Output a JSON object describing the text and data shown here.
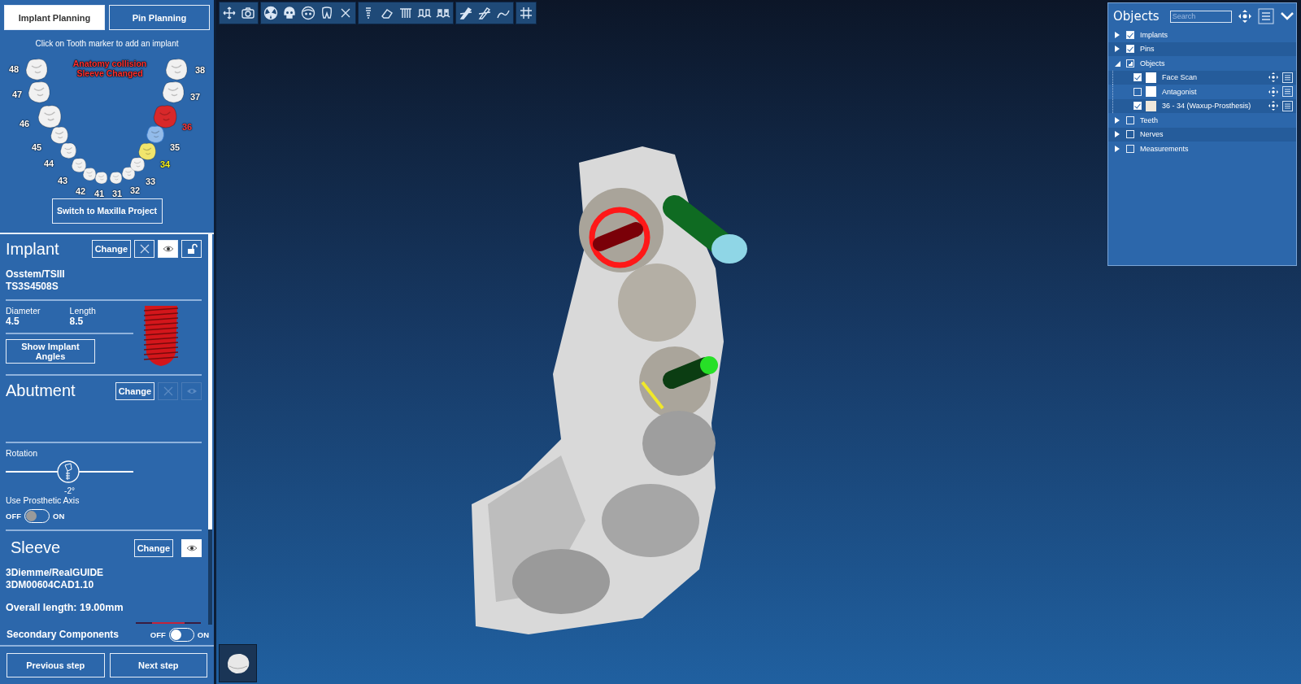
{
  "tabs": [
    {
      "label": "Implant Planning",
      "selected": true
    },
    {
      "label": "Pin Planning",
      "selected": false
    }
  ],
  "tooth_chart": {
    "hint": "Click on Tooth marker to add an implant",
    "warnings": [
      "Anatomy collision",
      "Sleeve Changed"
    ],
    "teeth": [
      {
        "label": "48",
        "implant": false,
        "selected": false,
        "highlighted": false
      },
      {
        "label": "47",
        "implant": false,
        "selected": false,
        "highlighted": false
      },
      {
        "label": "46",
        "implant": false,
        "selected": false,
        "highlighted": false
      },
      {
        "label": "45",
        "implant": false,
        "selected": false,
        "highlighted": false
      },
      {
        "label": "44",
        "implant": false,
        "selected": false,
        "highlighted": false
      },
      {
        "label": "43",
        "implant": false,
        "selected": false,
        "highlighted": false
      },
      {
        "label": "42",
        "implant": false,
        "selected": false,
        "highlighted": false
      },
      {
        "label": "41",
        "implant": false,
        "selected": false,
        "highlighted": false
      },
      {
        "label": "31",
        "implant": false,
        "selected": false,
        "highlighted": false
      },
      {
        "label": "32",
        "implant": false,
        "selected": false,
        "highlighted": false
      },
      {
        "label": "33",
        "implant": false,
        "selected": false,
        "highlighted": false
      },
      {
        "label": "34",
        "implant": false,
        "selected": true,
        "highlighted": false
      },
      {
        "label": "35",
        "implant": false,
        "selected": false,
        "highlighted": true
      },
      {
        "label": "36",
        "implant": true,
        "selected": false,
        "highlighted": false
      },
      {
        "label": "37",
        "implant": false,
        "selected": false,
        "highlighted": false
      },
      {
        "label": "38",
        "implant": false,
        "selected": false,
        "highlighted": false
      }
    ],
    "switch_button": "Switch to Maxilla Project"
  },
  "implant": {
    "title": "Implant",
    "change_button": "Change",
    "visible": true,
    "locked": false,
    "brand": "Osstem/TSIII",
    "code": "TS3S4508S",
    "diameter_label": "Diameter",
    "diameter": "4.5",
    "length_label": "Length",
    "length": "8.5",
    "angles_button": "Show Implant Angles"
  },
  "abutment": {
    "title": "Abutment",
    "change_button": "Change",
    "disabled": true,
    "rotation_label": "Rotation",
    "rotation": {
      "level": 0.49,
      "reading": "-2°"
    },
    "axis_label": "Use Prosthetic Axis",
    "axis_toggle": {
      "off_label": "OFF",
      "on_label": "ON",
      "on": false
    }
  },
  "sleeve": {
    "title": "Sleeve",
    "change_button": "Change",
    "visible": true,
    "brand": "3Diemme/RealGUIDE",
    "code": "3DM00604CAD1.10",
    "overall_length": "Overall length: 19.00mm",
    "secondary_label": "Secondary Components",
    "secondary_toggle": {
      "off_label": "OFF",
      "on_label": "ON",
      "on": false
    }
  },
  "nav_buttons": [
    "Previous step",
    "Next step"
  ],
  "objects_panel": {
    "title": "Objects",
    "search_placeholder": "Search",
    "items": [
      {
        "label": "Implants",
        "checked": true,
        "partial": false,
        "expanded": false
      },
      {
        "label": "Pins",
        "checked": true,
        "partial": false,
        "expanded": false
      },
      {
        "label": "Objects",
        "checked": true,
        "partial": true,
        "expanded": true,
        "children": [
          {
            "label": "Face Scan",
            "checked": true,
            "color": "#ffffff"
          },
          {
            "label": "Antagonist",
            "checked": false,
            "color": "#ffffff"
          },
          {
            "label": "36 - 34 (Waxup-Prosthesis)",
            "checked": true,
            "color": "#efe8dc"
          }
        ]
      },
      {
        "label": "Teeth",
        "checked": false,
        "partial": false,
        "expanded": false
      },
      {
        "label": "Nerves",
        "checked": false,
        "partial": false,
        "expanded": false
      },
      {
        "label": "Measurements",
        "checked": false,
        "partial": false,
        "expanded": false
      }
    ]
  }
}
